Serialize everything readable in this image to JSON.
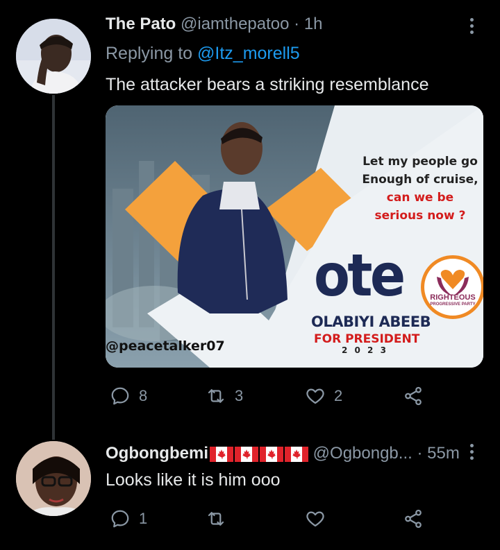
{
  "tweet1": {
    "display_name": "The Pato",
    "handle": "@iamthepatoo",
    "separator": "·",
    "time": "1h",
    "replying_prefix": "Replying to",
    "replying_to": "@Itz_morell5",
    "text": "The attacker bears a striking resemblance",
    "media": {
      "poster_lines": [
        "Let my people go",
        "Enough of cruise,",
        "can we be",
        "serious now ?"
      ],
      "vote_word": "ote",
      "party_line1": "RIGHTEOUS",
      "party_line2": "PROGRESSIVE PARTY",
      "candidate": "OLABIYI ABEEB",
      "for_president": "FOR PRESIDENT",
      "year": "2 0 2 3",
      "watermark": "@peacetalker07"
    },
    "actions": {
      "replies": "8",
      "retweets": "3",
      "likes": "2"
    }
  },
  "tweet2": {
    "display_name": "Ogbongbemi",
    "flags": [
      "canada-flag",
      "canada-flag",
      "canada-flag",
      "canada-flag"
    ],
    "handle": "@Ogbongb...",
    "separator": "·",
    "time": "55m",
    "text": "Looks like it is him ooo",
    "actions": {
      "replies": "1",
      "retweets": "",
      "likes": ""
    }
  },
  "colors": {
    "background": "#000000",
    "text": "#e7e9ea",
    "muted": "#8b98a5",
    "link": "#1d9bf0",
    "poster_orange": "#f4a13c",
    "poster_red": "#d31c1c"
  }
}
